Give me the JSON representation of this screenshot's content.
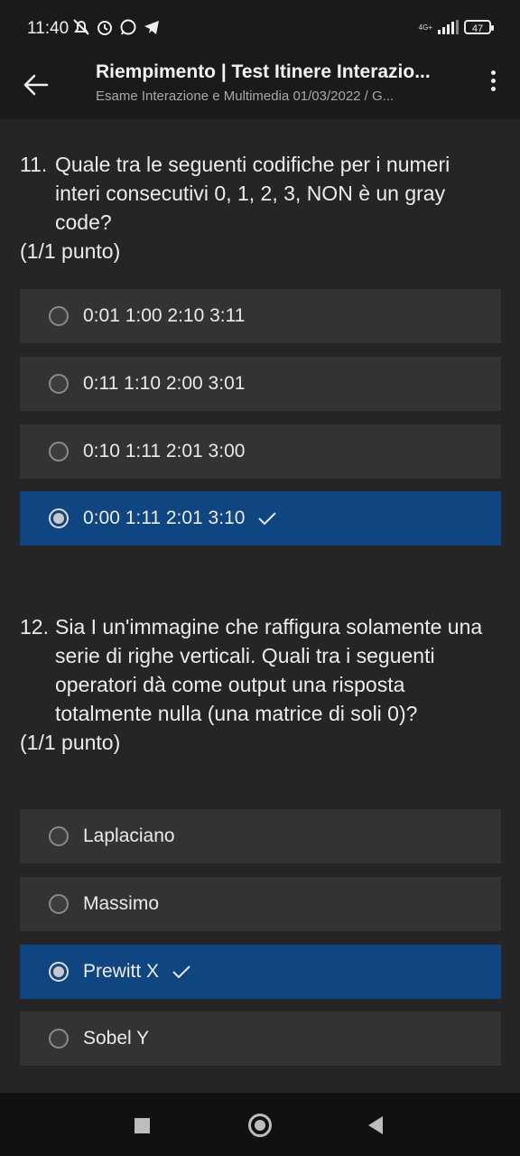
{
  "status_bar": {
    "time": "11:40",
    "network": "4G+",
    "battery": "47"
  },
  "app_bar": {
    "title": "Riempimento | Test Itinere Interazio...",
    "subtitle": "Esame Interazione e Multimedia 01/03/2022 / G..."
  },
  "questions": [
    {
      "number": "11.",
      "text": "Quale tra le seguenti codifiche per i numeri interi consecutivi 0, 1, 2, 3, NON è un gray code?",
      "points": "(1/1 punto)",
      "options": [
        {
          "label": "0:01 1:00 2:10 3:11",
          "selected": false
        },
        {
          "label": "0:11 1:10 2:00 3:01",
          "selected": false
        },
        {
          "label": "0:10 1:11 2:01 3:00",
          "selected": false
        },
        {
          "label": "0:00 1:11 2:01 3:10",
          "selected": true
        }
      ]
    },
    {
      "number": "12.",
      "text": "Sia I un'immagine che raffigura solamente una serie di righe verticali. Quali tra i seguenti operatori dà come output una risposta totalmente nulla (una matrice di soli 0)?",
      "points": "(1/1 punto)",
      "options": [
        {
          "label": "Laplaciano",
          "selected": false
        },
        {
          "label": "Massimo",
          "selected": false
        },
        {
          "label": "Prewitt X",
          "selected": true
        },
        {
          "label": "Sobel Y",
          "selected": false
        }
      ]
    }
  ],
  "colors": {
    "background": "#252525",
    "option": "#333333",
    "selected": "#0f4580"
  }
}
